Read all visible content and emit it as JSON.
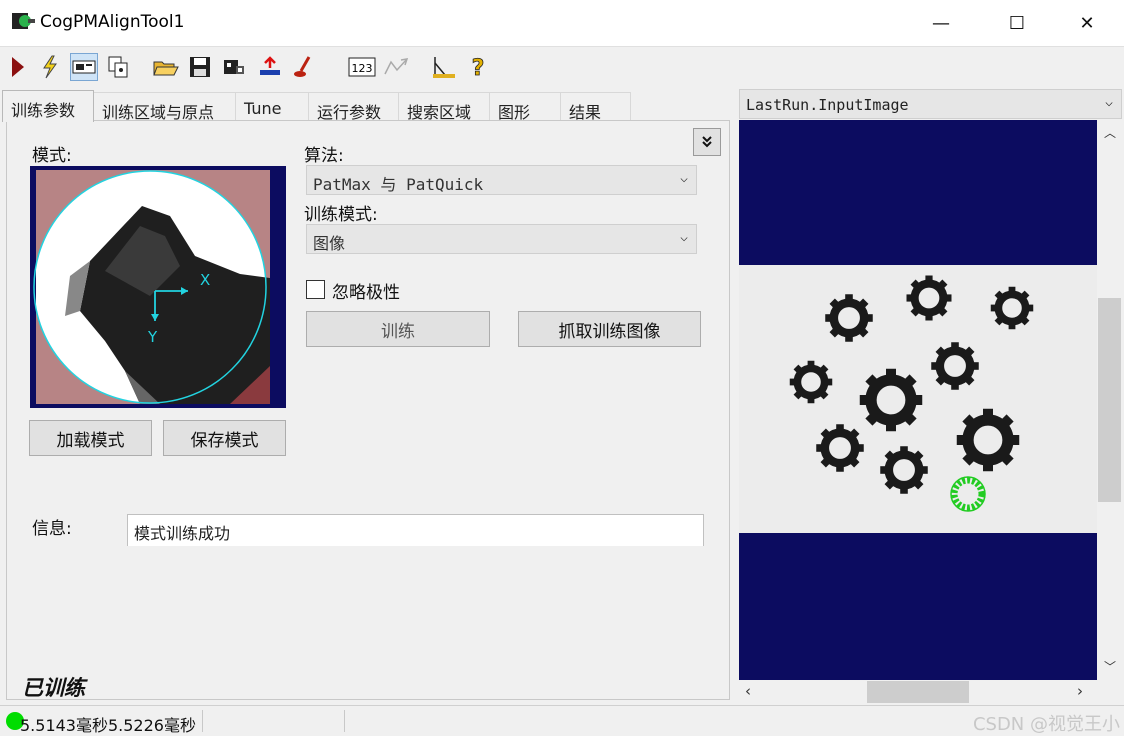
{
  "window": {
    "title": "CogPMAlignTool1",
    "min_glyph": "—",
    "max_glyph": "☐",
    "close_glyph": "✕"
  },
  "toolbar": {
    "icons": [
      "run-icon",
      "electric-run-icon",
      "display-toggle-icon",
      "copy-icon",
      "open-folder-icon",
      "save-icon",
      "image-source-icon",
      "import-icon",
      "graphics-icon",
      "numeric-display-icon",
      "edit-icon",
      "ruler-icon",
      "help-icon"
    ],
    "numeric_label": "123"
  },
  "tabs": [
    {
      "label": "训练参数",
      "active": true
    },
    {
      "label": "训练区域与原点",
      "active": false
    },
    {
      "label": "Tune",
      "active": false
    },
    {
      "label": "运行参数",
      "active": false
    },
    {
      "label": "搜索区域",
      "active": false
    },
    {
      "label": "图形",
      "active": false
    },
    {
      "label": "结果",
      "active": false
    }
  ],
  "train_params": {
    "pattern_label": "模式:",
    "algorithm_label": "算法:",
    "algorithm_value": "PatMax 与 PatQuick",
    "train_mode_label": "训练模式:",
    "train_mode_value": "图像",
    "ignore_polarity_label": "忽略极性",
    "ignore_polarity_checked": false,
    "train_button": "训练",
    "grab_train_image_button": "抓取训练图像",
    "load_pattern_button": "加载模式",
    "save_pattern_button": "保存模式",
    "info_label": "信息:",
    "info_value": "模式训练成功",
    "trained_status": "已训练",
    "collapse_glyph": "⌄",
    "axis_x": "X",
    "axis_y": "Y"
  },
  "display": {
    "image_selector": "LastRun.InputImage"
  },
  "status": {
    "text": "5.5143毫秒5.5226毫秒",
    "indicator_color": "#00dd00",
    "watermark": "CSDN @视觉王小"
  },
  "colors": {
    "display_bg": "#0c0c60",
    "gear_dark": "#1a1a1a",
    "match_green": "#22cc22",
    "pattern_cyan": "#22d3e0"
  }
}
